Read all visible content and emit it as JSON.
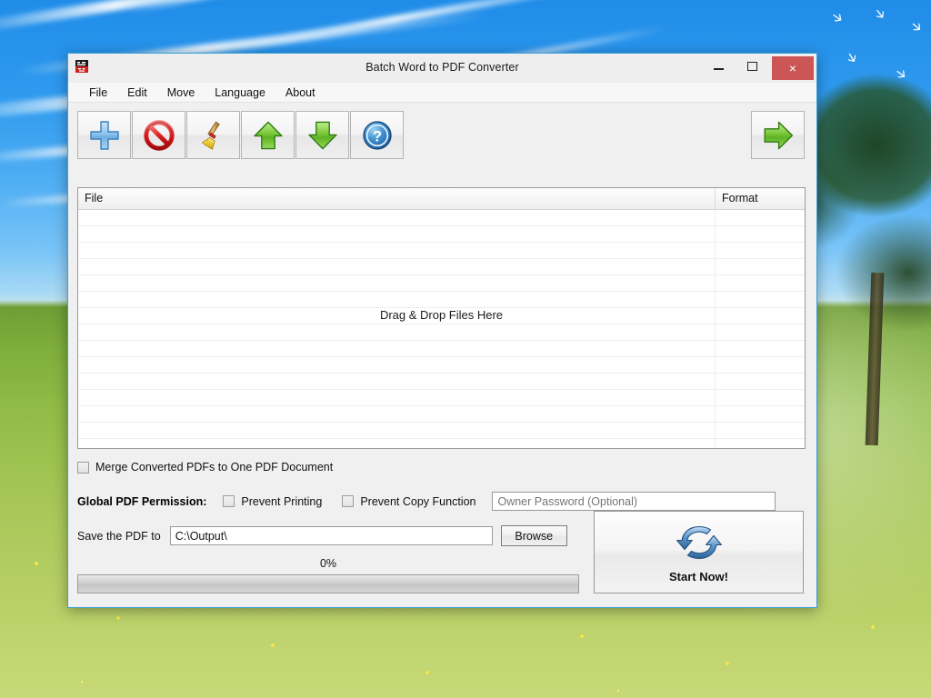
{
  "window": {
    "title": "Batch Word to PDF Converter",
    "app_icon": "app-icon",
    "controls": {
      "minimize": "minimize-button",
      "maximize": "maximize-button",
      "close_glyph": "×"
    }
  },
  "menubar": {
    "items": [
      {
        "label": "File"
      },
      {
        "label": "Edit"
      },
      {
        "label": "Move"
      },
      {
        "label": "Language"
      },
      {
        "label": "About"
      }
    ]
  },
  "toolbar": {
    "buttons": [
      {
        "name": "add-files-button",
        "icon": "plus-icon"
      },
      {
        "name": "remove-file-button",
        "icon": "prohibition-icon"
      },
      {
        "name": "clear-list-button",
        "icon": "broom-icon"
      },
      {
        "name": "move-up-button",
        "icon": "arrow-up-icon"
      },
      {
        "name": "move-down-button",
        "icon": "arrow-down-icon"
      },
      {
        "name": "help-button",
        "icon": "question-mark-icon"
      }
    ],
    "go_button": {
      "name": "next-button",
      "icon": "arrow-right-icon"
    }
  },
  "filelist": {
    "columns": [
      "File",
      "Format"
    ],
    "rows": [],
    "row_count": 15,
    "empty_hint": "Drag & Drop Files Here"
  },
  "options": {
    "merge_label": "Merge Converted PDFs to One PDF Document",
    "merge_checked": false,
    "permission_title": "Global PDF Permission:",
    "prevent_printing_label": "Prevent Printing",
    "prevent_printing_checked": false,
    "prevent_copy_label": "Prevent Copy Function",
    "prevent_copy_checked": false,
    "owner_password_value": "",
    "owner_password_placeholder": "Owner Password (Optional)"
  },
  "output": {
    "label": "Save the PDF to",
    "path_value": "C:\\Output\\",
    "path_placeholder": "",
    "browse_label": "Browse"
  },
  "progress": {
    "percent_label": "0%",
    "percent_value": 0
  },
  "start": {
    "label": "Start Now!",
    "icon": "refresh-arrows-icon"
  },
  "colors": {
    "window_border": "#3aa0d6",
    "close_button": "#cc5555",
    "chrome": "#f0f0f0",
    "accent_green": "#5aa82d",
    "accent_blue": "#2f7fc4"
  }
}
